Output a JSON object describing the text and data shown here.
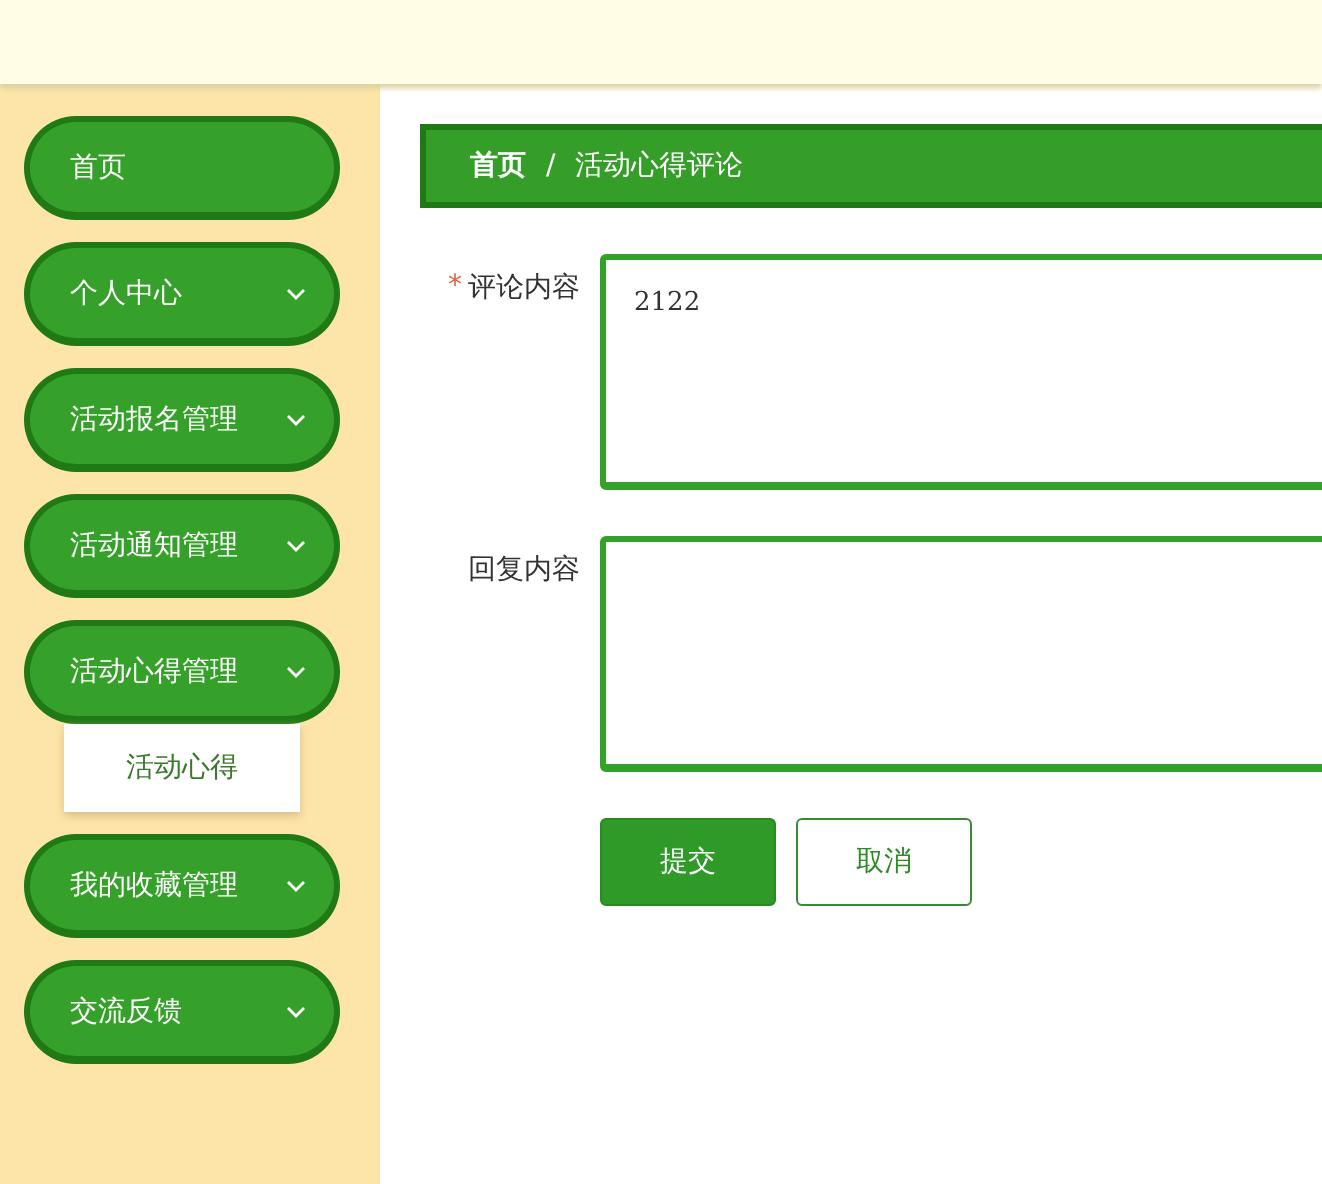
{
  "sidebar": {
    "items": [
      {
        "label": "首页",
        "kind": "link"
      },
      {
        "label": "个人中心",
        "kind": "group"
      },
      {
        "label": "活动报名管理",
        "kind": "group"
      },
      {
        "label": "活动通知管理",
        "kind": "group"
      },
      {
        "label": "活动心得管理",
        "kind": "group",
        "children": [
          {
            "label": "活动心得"
          }
        ]
      },
      {
        "label": "我的收藏管理",
        "kind": "group"
      },
      {
        "label": "交流反馈",
        "kind": "group"
      }
    ]
  },
  "breadcrumb": [
    "首页",
    "活动心得评论"
  ],
  "breadcrumb_separator": "/",
  "form": {
    "fields": [
      {
        "label": "评论内容",
        "required_mark": "*",
        "value": "2122"
      },
      {
        "label": "回复内容"
      }
    ],
    "buttons": [
      {
        "label": "提交",
        "kind": "primary"
      },
      {
        "label": "取消",
        "kind": "secondary"
      }
    ]
  }
}
